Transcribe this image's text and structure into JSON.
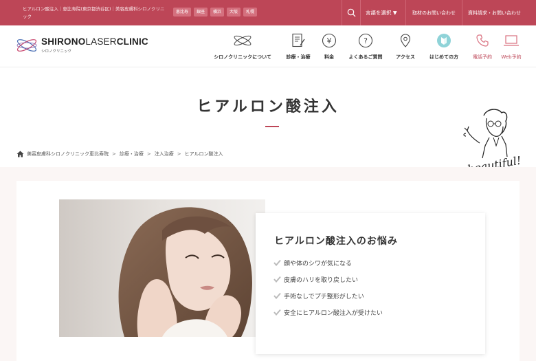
{
  "topbar": {
    "description": "ヒアルロン酸注入｜恵比寿院(東京都渋谷区)｜美容皮膚科シロノクリニック",
    "areas": [
      "恵比寿",
      "銀座",
      "横浜",
      "大阪",
      "札幌"
    ],
    "language_label": "言語を選択 ▼",
    "press_label": "取材のお問い合わせ",
    "docs_label": "資料請求・お問い合わせ"
  },
  "brand": {
    "name_bold_1": "SHIRONO",
    "name_light": "LASER",
    "name_bold_2": "CLINIC",
    "sub": "シロノクリニック"
  },
  "nav": {
    "items": [
      {
        "label": "シロノクリニックについて",
        "icon": "clinic-logo-icon"
      },
      {
        "label": "診療・治療",
        "icon": "document-icon"
      },
      {
        "label": "料金",
        "icon": "yen-icon"
      },
      {
        "label": "よくあるご質問",
        "icon": "question-icon"
      },
      {
        "label": "アクセス",
        "icon": "map-pin-icon"
      },
      {
        "label": "はじめての方",
        "icon": "beginner-icon"
      }
    ],
    "phone_label": "電話予約",
    "web_label": "Web予約"
  },
  "page_title": "ヒアルロン酸注入",
  "mascot_text": "Be beautiful!",
  "breadcrumb": {
    "items": [
      "美容皮膚科シロノクリニック恵比寿院",
      "診療・治療",
      "注入治療",
      "ヒアルロン酸注入"
    ]
  },
  "concerns": {
    "heading": "ヒアルロン酸注入のお悩み",
    "items": [
      "顔や体のシワが気になる",
      "皮膚のハリを取り戻したい",
      "手術なしでプチ整形がしたい",
      "安全にヒアルロン酸注入が受けたい"
    ]
  },
  "colors": {
    "brand": "#bd4657",
    "check": "#bbbbbb"
  }
}
